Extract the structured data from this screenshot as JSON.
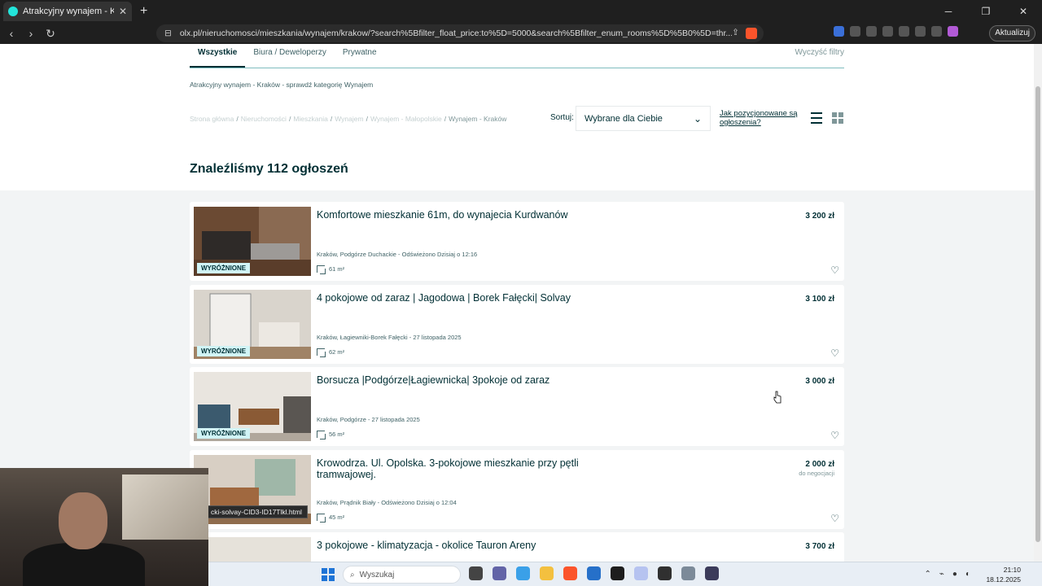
{
  "browser": {
    "tab_title": "Atrakcyjny wynajem - Kraków - ",
    "url": "olx.pl/nieruchomosci/mieszkania/wynajem/krakow/?search%5Bfilter_float_price:to%5D=5000&search%5Bfilter_enum_rooms%5D%5B0%5D=thr...",
    "update_label": "Aktualizuj",
    "brave_badge": "8"
  },
  "filters": {
    "tabs": [
      "Wszystkie",
      "Biura / Deweloperzy",
      "Prywatne"
    ],
    "clear": "Wyczyść filtry"
  },
  "promo": "Atrakcyjny wynajem - Kraków - sprawdź kategorię Wynajem",
  "breadcrumb": [
    "Strona główna",
    "Nieruchomości",
    "Mieszkania",
    "Wynajem",
    "Wynajem - Małopolskie",
    "Wynajem - Kraków"
  ],
  "sort": {
    "label": "Sortuj:",
    "value": "Wybrane dla Ciebie",
    "position_link": "Jak pozycjonowane są ogłoszenia?"
  },
  "result_heading": "Znaleźliśmy 112 ogłoszeń",
  "listings": [
    {
      "title": "Komfortowe mieszkanie 61m, do wynajecia Kurdwanów",
      "price": "3 200 zł",
      "negotiable": "",
      "location": "Kraków, Podgórze Duchackie - Odświeżono Dzisiaj o 12:16",
      "area": "61 m²",
      "badge": "WYRÓŻNIONE"
    },
    {
      "title": "4 pokojowe od zaraz | Jagodowa | Borek Fałęcki| Solvay",
      "price": "3 100 zł",
      "negotiable": "",
      "location": "Kraków, Łagiewniki-Borek Fałęcki - 27 listopada 2025",
      "area": "62 m²",
      "badge": "WYRÓŻNIONE"
    },
    {
      "title": "Borsucza |Podgórze|Łagiewnicka| 3pokoje od zaraz",
      "price": "3 000 zł",
      "negotiable": "",
      "location": "Kraków, Podgórze - 27 listopada 2025",
      "area": "56 m²",
      "badge": "WYRÓŻNIONE"
    },
    {
      "title": "Krowodrza. Ul. Opolska. 3-pokojowe mieszkanie przy pętli tramwajowej.",
      "price": "2 000 zł",
      "negotiable": "do negocjacji",
      "location": "Kraków, Prądnik Biały - Odświeżono Dzisiaj o 12:04",
      "area": "45 m²",
      "badge": ""
    },
    {
      "title": "3 pokojowe - klimatyzacja - okolice Tauron Areny",
      "price": "3 700 zł",
      "negotiable": "",
      "location": "",
      "area": "",
      "badge": ""
    }
  ],
  "status_url": "cki-solvay-CID3-ID17Tlkl.html",
  "taskbar": {
    "search_placeholder": "Wyszukaj",
    "time": "21:10",
    "date": "18.12.2025"
  }
}
